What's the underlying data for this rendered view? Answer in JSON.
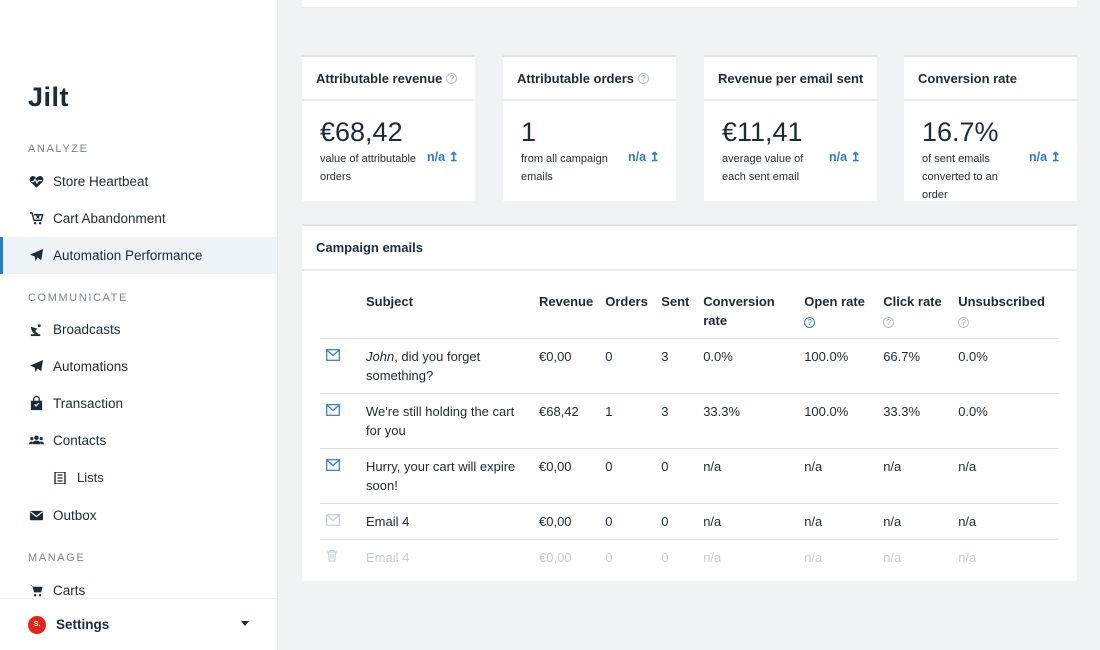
{
  "sidebar": {
    "logo": "Jilt",
    "sections": {
      "analyze": "ANALYZE",
      "communicate": "COMMUNICATE",
      "manage": "MANAGE"
    },
    "items": {
      "store_heartbeat": "Store Heartbeat",
      "cart_abandonment": "Cart Abandonment",
      "automation_performance": "Automation Performance",
      "broadcasts": "Broadcasts",
      "automations": "Automations",
      "transaction": "Transaction",
      "contacts": "Contacts",
      "lists": "Lists",
      "outbox": "Outbox",
      "carts": "Carts"
    },
    "settings": {
      "avatar": "S.",
      "label": "Settings"
    }
  },
  "stats": [
    {
      "title": "Attributable revenue",
      "value": "€68,42",
      "desc": "value of attributable orders",
      "trend": "n/a ↥"
    },
    {
      "title": "Attributable orders",
      "value": "1",
      "desc": "from all campaign emails",
      "trend": "n/a ↥"
    },
    {
      "title": "Revenue per email sent",
      "value": "€11,41",
      "desc": "average value of each sent email",
      "trend": "n/a ↥"
    },
    {
      "title": "Conversion rate",
      "value": "16.7%",
      "desc": "of sent emails converted to an order",
      "trend": "n/a ↥"
    }
  ],
  "help_glyph": "?",
  "campaign": {
    "title": "Campaign emails",
    "columns": {
      "subject": "Subject",
      "revenue": "Revenue",
      "orders": "Orders",
      "sent": "Sent",
      "conversion": "Conversion rate",
      "open": "Open rate",
      "click": "Click rate",
      "unsub": "Unsubscribed"
    },
    "rows": [
      {
        "subject_name": "John",
        "subject_rest": ", did you forget something?",
        "revenue": "€0,00",
        "orders": "0",
        "sent": "3",
        "conversion": "0.0%",
        "open": "100.0%",
        "click": "66.7%",
        "unsub": "0.0%"
      },
      {
        "subject": "We're still holding the cart for you",
        "revenue": "€68,42",
        "orders": "1",
        "sent": "3",
        "conversion": "33.3%",
        "open": "100.0%",
        "click": "33.3%",
        "unsub": "0.0%"
      },
      {
        "subject": "Hurry, your cart will expire soon!",
        "revenue": "€0,00",
        "orders": "0",
        "sent": "0",
        "conversion": "n/a",
        "open": "n/a",
        "click": "n/a",
        "unsub": "n/a"
      },
      {
        "subject": "Email 4",
        "revenue": "€0,00",
        "orders": "0",
        "sent": "0",
        "conversion": "n/a",
        "open": "n/a",
        "click": "n/a",
        "unsub": "n/a"
      },
      {
        "subject": "Email 4",
        "revenue": "€0,00",
        "orders": "0",
        "sent": "0",
        "conversion": "n/a",
        "open": "n/a",
        "click": "n/a",
        "unsub": "n/a"
      }
    ]
  },
  "colors": {
    "accent": "#2c7cc3",
    "brand_avatar": "#e2251b",
    "text": "#1c2b3a",
    "muted": "#c6ccd3"
  }
}
